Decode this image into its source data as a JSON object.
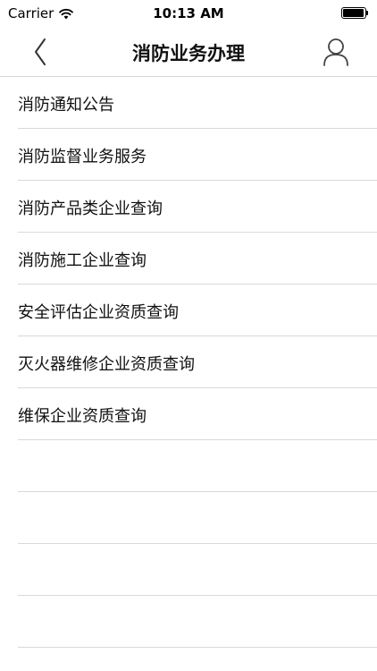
{
  "status_bar": {
    "carrier": "Carrier",
    "time": "10:13 AM"
  },
  "nav": {
    "title": "消防业务办理",
    "back_icon": "chevron-left-icon",
    "user_icon": "user-icon"
  },
  "list": {
    "items": [
      {
        "label": "消防通知公告"
      },
      {
        "label": "消防监督业务服务"
      },
      {
        "label": "消防产品类企业查询"
      },
      {
        "label": "消防施工企业查询"
      },
      {
        "label": "安全评估企业资质查询"
      },
      {
        "label": "灭火器维修企业资质查询"
      },
      {
        "label": "维保企业资质查询"
      }
    ]
  }
}
